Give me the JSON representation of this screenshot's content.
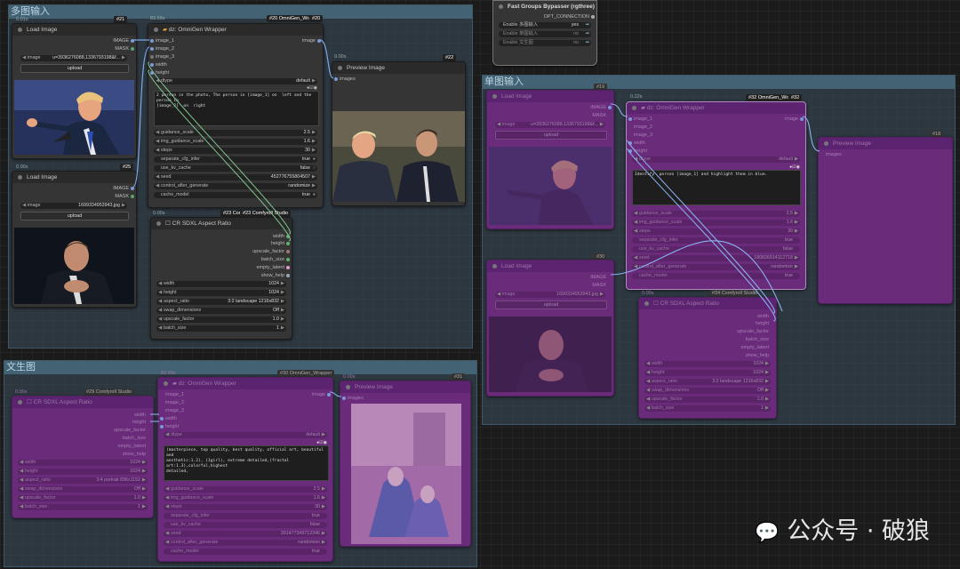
{
  "groups": {
    "multi": {
      "title": "多图输入"
    },
    "single": {
      "title": "单图输入"
    },
    "text": {
      "title": "文生图"
    }
  },
  "bypasser": {
    "title": "Fast Groups Bypasser (rgthree)",
    "output": "OPT_CONNECTION",
    "rows": [
      {
        "label": "Enable 多图输入",
        "value": "yes"
      },
      {
        "label": "Enable 单图输入",
        "value": "no"
      },
      {
        "label": "Enable 文生图",
        "value": "no"
      }
    ]
  },
  "load1": {
    "time": "0.01s",
    "badge": "#21",
    "title": "Load Image",
    "out1": "IMAGE",
    "out2": "MASK",
    "image_label": "image",
    "image_value": "u=3936276088,1336793198&f...",
    "upload": "upload"
  },
  "load2": {
    "time": "0.00s",
    "badge": "#25",
    "title": "Load Image",
    "out1": "IMAGE",
    "out2": "MASK",
    "image_label": "image",
    "image_value": "1699334953943.jpg",
    "upload": "upload"
  },
  "omni": {
    "time": "83.99s",
    "badge": "#20 OmniGen_Wra",
    "badge2": "#20",
    "title": "dz: OmniGen Wrapper",
    "inputs": [
      "image_1",
      "image_2",
      "image_3",
      "width",
      "height"
    ],
    "output": "image",
    "dtype_label": "dtype",
    "dtype_value": "default",
    "prompt": "2 person in the photo, The person in [image_1] on  left and the person in\n[image_2]  on  right",
    "widgets": [
      {
        "label": "guidance_scale",
        "value": "2.5"
      },
      {
        "label": "img_guidance_scale",
        "value": "1.6"
      },
      {
        "label": "steps",
        "value": "30"
      },
      {
        "label": "separate_cfg_infer",
        "value": "true"
      },
      {
        "label": "use_kv_cache",
        "value": "false"
      },
      {
        "label": "seed",
        "value": "452776755804507"
      },
      {
        "label": "control_after_generate",
        "value": "randomize"
      },
      {
        "label": "cache_model",
        "value": "true"
      }
    ]
  },
  "preview1": {
    "time": "0.00s",
    "badge": "#22",
    "title": "Preview Image",
    "input": "images"
  },
  "aspect1": {
    "time": "0.00s",
    "badge": "#23 Cor",
    "badge2": "#23 Comfyroll Studio",
    "title": "CR SDXL Aspect Ratio",
    "outputs": [
      "width",
      "height",
      "upscale_factor",
      "batch_size",
      "empty_latent",
      "show_help"
    ],
    "widgets": [
      {
        "label": "width",
        "value": "1024"
      },
      {
        "label": "height",
        "value": "1024"
      },
      {
        "label": "aspect_ratio",
        "value": "3:2 landscape 1216x832"
      },
      {
        "label": "swap_dimensions",
        "value": "Off"
      },
      {
        "label": "upscale_factor",
        "value": "1.0"
      },
      {
        "label": "batch_size",
        "value": "1"
      }
    ]
  },
  "single_load1": {
    "badge": "#19",
    "title": "Load Image",
    "out1": "IMAGE",
    "out2": "MASK",
    "image_label": "image",
    "image_value": "u=3936276088,1336793198&f...",
    "upload": "upload"
  },
  "single_load2": {
    "badge": "#30",
    "title": "Load Image",
    "out1": "IMAGE",
    "out2": "MASK",
    "image_label": "image",
    "image_value": "1699334953943.jpg",
    "upload": "upload"
  },
  "single_omni": {
    "time": "0.22s",
    "badge": "#32 OmniGen_Wra",
    "badge2": "#32",
    "title": "dz: OmniGen Wrapper",
    "inputs": [
      "image_1",
      "image_2",
      "image_3",
      "width",
      "height"
    ],
    "output": "image",
    "dtype_label": "dtype",
    "dtype_value": "default",
    "prompt": "Identify  person [image_1] and highlight them in blue.",
    "widgets": [
      {
        "label": "guidance_scale",
        "value": "2.5"
      },
      {
        "label": "img_guidance_scale",
        "value": "1.6"
      },
      {
        "label": "steps",
        "value": "30"
      },
      {
        "label": "separate_cfg_infer",
        "value": "true"
      },
      {
        "label": "use_kv_cache",
        "value": "false"
      },
      {
        "label": "seed",
        "value": "180826914112718"
      },
      {
        "label": "control_after_generate",
        "value": "randomize"
      },
      {
        "label": "cache_model",
        "value": "true"
      }
    ]
  },
  "single_preview": {
    "badge": "#18",
    "title": "Preview Image",
    "input": "images"
  },
  "single_aspect": {
    "time": "0.00s",
    "badge": "#34 Comfyroll Studio",
    "title": "CR SDXL Aspect Ratio",
    "outputs": [
      "width",
      "height",
      "upscale_factor",
      "batch_size",
      "empty_latent",
      "show_help"
    ],
    "widgets": [
      {
        "label": "width",
        "value": "1024"
      },
      {
        "label": "height",
        "value": "1024"
      },
      {
        "label": "aspect_ratio",
        "value": "3:2 landscape 1216x832"
      },
      {
        "label": "swap_dimensions",
        "value": "Off"
      },
      {
        "label": "upscale_factor",
        "value": "1.0"
      },
      {
        "label": "batch_size",
        "value": "1"
      }
    ]
  },
  "text_aspect": {
    "time": "0.00s",
    "badge": "#29 Comfyroll Studio",
    "title": "CR SDXL Aspect Ratio",
    "outputs": [
      "width",
      "height",
      "upscale_factor",
      "batch_size",
      "empty_latent",
      "show_help"
    ],
    "widgets": [
      {
        "label": "width",
        "value": "1024"
      },
      {
        "label": "height",
        "value": "1024"
      },
      {
        "label": "aspect_ratio",
        "value": "3:4 portrait 896x1152"
      },
      {
        "label": "swap_dimensions",
        "value": "Off"
      },
      {
        "label": "upscale_factor",
        "value": "1.0"
      },
      {
        "label": "batch_size",
        "value": "1"
      }
    ]
  },
  "text_omni": {
    "time": "83.99s",
    "badge": "#30 OmniGen_Wrapper",
    "title": "dz: OmniGen Wrapper",
    "inputs": [
      "image_1",
      "image_2",
      "image_3",
      "width",
      "height"
    ],
    "output": "image",
    "dtype_label": "dtype",
    "dtype_value": "default",
    "prompt": "(masterpiece, top quality, best quality, official art, beautiful and\naesthetic:1.2), (1girl), extreme detailed,(fractal art:1.3),colorful,highest\ndetailed,",
    "widgets": [
      {
        "label": "guidance_scale",
        "value": "2.5"
      },
      {
        "label": "img_guidance_scale",
        "value": "1.6"
      },
      {
        "label": "steps",
        "value": "30"
      },
      {
        "label": "separate_cfg_infer",
        "value": "true"
      },
      {
        "label": "use_kv_cache",
        "value": "false"
      },
      {
        "label": "seed",
        "value": "391477349712346"
      },
      {
        "label": "control_after_generate",
        "value": "randomize"
      },
      {
        "label": "cache_model",
        "value": "true"
      }
    ]
  },
  "text_preview": {
    "time": "0.00s",
    "badge": "#31",
    "title": "Preview Image",
    "input": "images"
  },
  "watermark": "公众号 · 破狼"
}
